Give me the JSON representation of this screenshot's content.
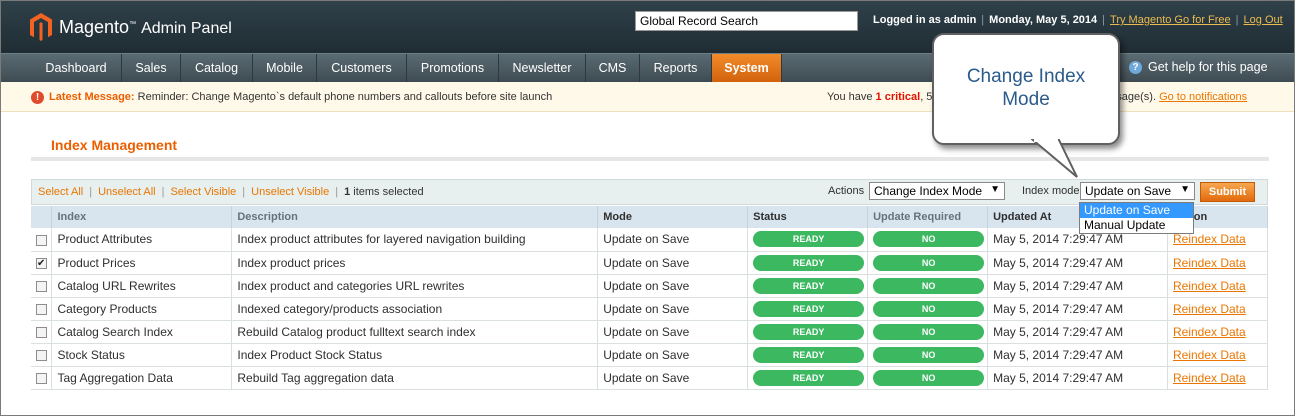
{
  "header": {
    "brand": "Magento",
    "brand_suffix": "Admin Panel",
    "search_value": "Global Record Search",
    "logged_in": "Logged in as admin",
    "date": "Monday, May 5, 2014",
    "try_link": "Try Magento Go for Free",
    "logout": "Log Out"
  },
  "nav": {
    "items": [
      "Dashboard",
      "Sales",
      "Catalog",
      "Mobile",
      "Customers",
      "Promotions",
      "Newsletter",
      "CMS",
      "Reports",
      "System"
    ],
    "active": "System",
    "help": "Get help for this page"
  },
  "message": {
    "title": "Latest Message:",
    "text": "Reminder: Change Magento`s default phone numbers and callouts before site launch",
    "right_prefix": "You have",
    "critical_count": "1 critical",
    "right_mid": ", 5",
    "right_tail": "message(s).",
    "link": "Go to notifications"
  },
  "page": {
    "title": "Index Management"
  },
  "massaction": {
    "select_all": "Select All",
    "unselect_all": "Unselect All",
    "select_visible": "Select Visible",
    "unselect_visible": "Unselect Visible",
    "selected_count": "1",
    "selected_text": "items selected",
    "actions_label": "Actions",
    "actions_value": "Change Index Mode",
    "mode_label": "Index mode",
    "mode_value": "Update on Save",
    "mode_options": [
      "Update on Save",
      "Manual Update"
    ],
    "submit": "Submit"
  },
  "table": {
    "headers": [
      "Index",
      "Description",
      "Mode",
      "Status",
      "Update Required",
      "Updated At",
      "Action"
    ],
    "rows": [
      {
        "checked": false,
        "index": "Product Attributes",
        "description": "Index product attributes for layered navigation building",
        "mode": "Update on Save",
        "status": "READY",
        "update": "NO",
        "updated": "May 5, 2014 7:29:47 AM",
        "action": "Reindex Data"
      },
      {
        "checked": true,
        "index": "Product Prices",
        "description": "Index product prices",
        "mode": "Update on Save",
        "status": "READY",
        "update": "NO",
        "updated": "May 5, 2014 7:29:47 AM",
        "action": "Reindex Data"
      },
      {
        "checked": false,
        "index": "Catalog URL Rewrites",
        "description": "Index product and categories URL rewrites",
        "mode": "Update on Save",
        "status": "READY",
        "update": "NO",
        "updated": "May 5, 2014 7:29:47 AM",
        "action": "Reindex Data"
      },
      {
        "checked": false,
        "index": "Category Products",
        "description": "Indexed category/products association",
        "mode": "Update on Save",
        "status": "READY",
        "update": "NO",
        "updated": "May 5, 2014 7:29:47 AM",
        "action": "Reindex Data"
      },
      {
        "checked": false,
        "index": "Catalog Search Index",
        "description": "Rebuild Catalog product fulltext search index",
        "mode": "Update on Save",
        "status": "READY",
        "update": "NO",
        "updated": "May 5, 2014 7:29:47 AM",
        "action": "Reindex Data"
      },
      {
        "checked": false,
        "index": "Stock Status",
        "description": "Index Product Stock Status",
        "mode": "Update on Save",
        "status": "READY",
        "update": "NO",
        "updated": "May 5, 2014 7:29:47 AM",
        "action": "Reindex Data"
      },
      {
        "checked": false,
        "index": "Tag Aggregation Data",
        "description": "Rebuild Tag aggregation data",
        "mode": "Update on Save",
        "status": "READY",
        "update": "NO",
        "updated": "May 5, 2014 7:29:47 AM",
        "action": "Reindex Data"
      }
    ]
  },
  "callout": {
    "line1": "Change Index",
    "line2": "Mode"
  },
  "icons": {
    "logo": "magento-logo-icon",
    "help": "help-icon",
    "message": "warning-icon",
    "caret": "chevron-down-icon"
  },
  "colors": {
    "accent": "#eb5e00",
    "ready": "#3cb861",
    "header": "#263740",
    "link": "#ea7601"
  }
}
